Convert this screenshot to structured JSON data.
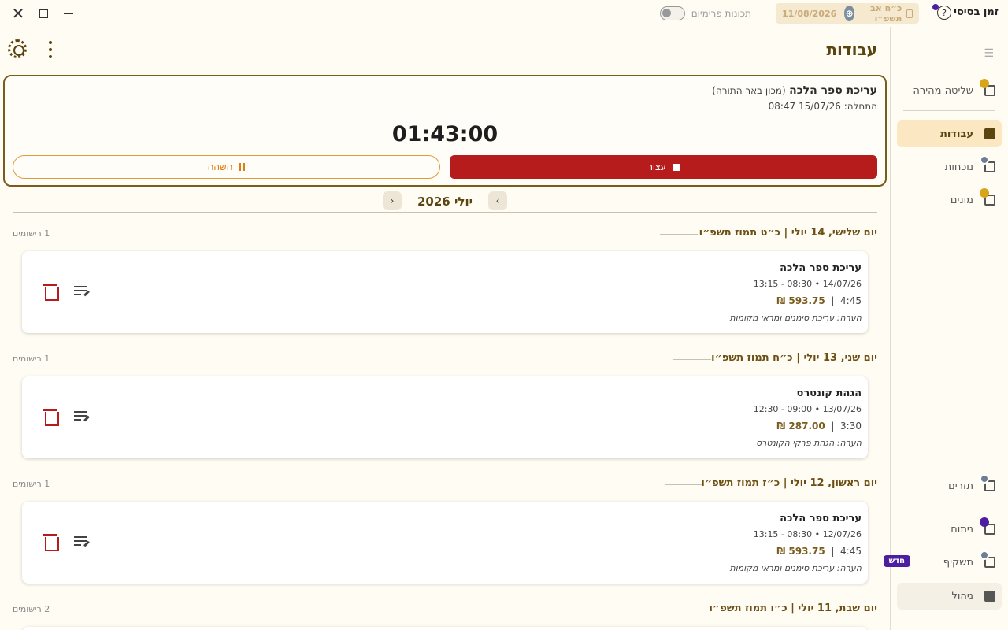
{
  "window": {
    "close_glyph": "✕"
  },
  "app": {
    "brand": "זמן בסיסי",
    "premium_label": "תכונות פרימיום",
    "hebrew_date": "כ״ח אב תשפ״ו",
    "gregorian_date": "11/08/2026",
    "brand_icon_glyph": "?"
  },
  "sidebar": {
    "items": [
      {
        "label": "שליטה מהירה",
        "icon": "quick-control-icon"
      },
      {
        "label": "עבודות",
        "icon": "clipboard-icon",
        "active": true
      },
      {
        "label": "נוכחות",
        "icon": "attendance-icon"
      },
      {
        "label": "מונים",
        "icon": "counters-icon"
      },
      {
        "label": "תזרים",
        "icon": "cashflow-icon"
      },
      {
        "label": "ניתוח",
        "icon": "analytics-icon"
      },
      {
        "label": "תשקיף",
        "icon": "forecast-icon",
        "badge": "חדש"
      },
      {
        "label": "ניהול",
        "icon": "archive-icon"
      }
    ]
  },
  "page": {
    "title": "עבודות"
  },
  "timer": {
    "job_name": "עריכת ספר הלכה",
    "client": "(מכון באר התורה)",
    "started": "התחלה: 15/07/26 08:47",
    "elapsed": "01:43:00",
    "stop_label": "עצור",
    "pause_label": "השהה"
  },
  "month": {
    "label": "יולי 2026",
    "prev_glyph": "‹",
    "next_glyph": "›"
  },
  "days": [
    {
      "title": "יום שלישי, 14 יולי | כ״ט תמוז תשפ״ו",
      "count": "1 רישומים",
      "entries": [
        {
          "title": "עריכת ספר הלכה",
          "time": "14/07/26 • 08:30 - 13:15",
          "duration": "4:45",
          "amount": "593.75 ₪",
          "note": "הערה: עריכת סימנים ומראי מקומות"
        }
      ]
    },
    {
      "title": "יום שני, 13 יולי | כ״ח תמוז תשפ״ו",
      "count": "1 רישומים",
      "entries": [
        {
          "title": "הגהת קונטרס",
          "time": "13/07/26 • 09:00 - 12:30",
          "duration": "3:30",
          "amount": "287.00 ₪",
          "note": "הערה: הגהת פרקי הקונטרס"
        }
      ]
    },
    {
      "title": "יום ראשון, 12 יולי | כ״ז תמוז תשפ״ו",
      "count": "1 רישומים",
      "entries": [
        {
          "title": "עריכת ספר הלכה",
          "time": "12/07/26 • 08:30 - 13:15",
          "duration": "4:45",
          "amount": "593.75 ₪",
          "note": "הערה: עריכת סימנים ומראי מקומות"
        }
      ]
    },
    {
      "title": "יום שבת, 11 יולי | כ״ו תמוז תשפ״ו",
      "count": "2 רישומים",
      "entries": []
    }
  ],
  "colors": {
    "accent": "#5a4410",
    "stop": "#b71c1c",
    "pause": "#e07b12",
    "active_nav": "#fbe7c2",
    "new_badge": "#4b1fa0"
  }
}
